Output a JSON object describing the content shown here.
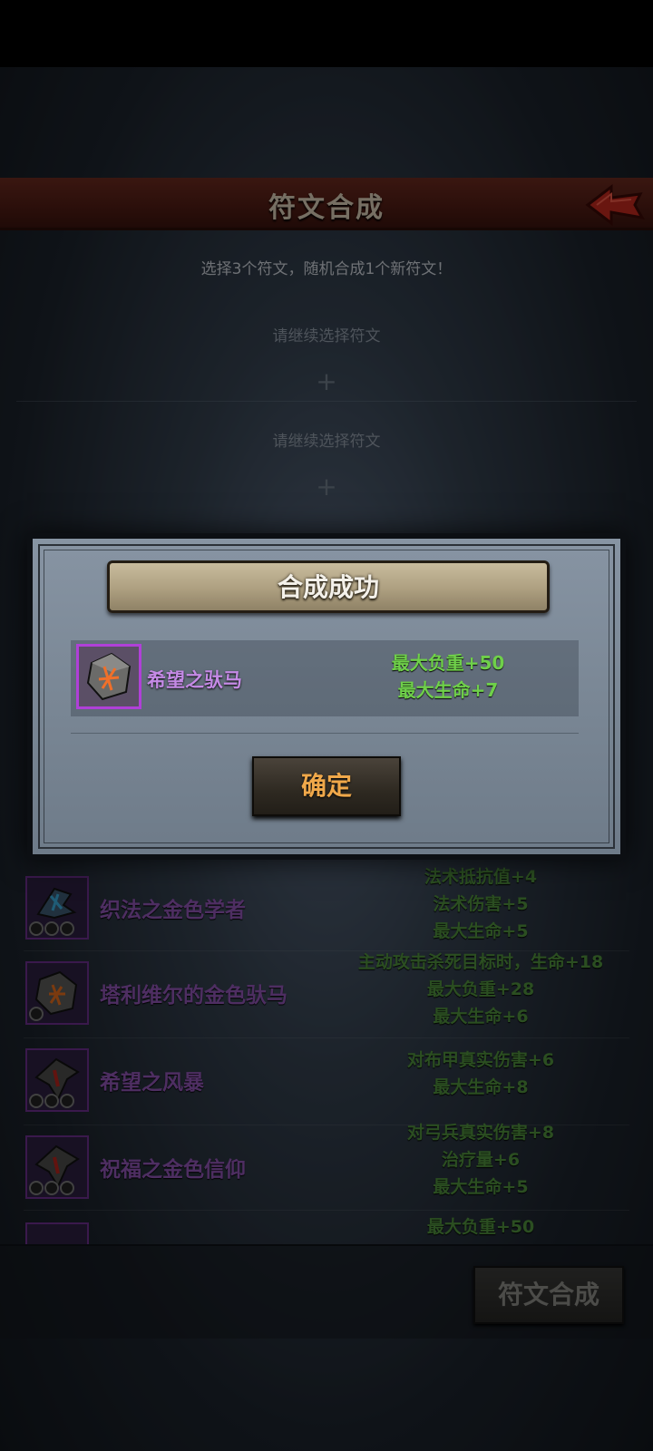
{
  "screen": {
    "title": "符文合成",
    "subtitle": "选择3个符文，随机合成1个新符文！",
    "slot_hints": [
      "请继续选择符文",
      "请继续选择符文"
    ],
    "plus": "+"
  },
  "rune_list": [
    {
      "name": "织法之金色学者",
      "stats": [
        "法术抵抗值+4",
        "法术伤害+5",
        "最大生命+5"
      ]
    },
    {
      "name": "塔利维尔的金色驮马",
      "stats": [
        "主动攻击杀死目标时，生命+18",
        "最大负重+28",
        "最大生命+6"
      ]
    },
    {
      "name": "希望之风暴",
      "stats": [
        "对布甲真实伤害+6",
        "最大生命+8"
      ]
    },
    {
      "name": "祝福之金色信仰",
      "stats": [
        "对弓兵真实伤害+8",
        "治疗量+6",
        "最大生命+5"
      ]
    },
    {
      "name": "",
      "stats": [
        "最大负重+50"
      ]
    }
  ],
  "compose_button": "符文合成",
  "modal": {
    "title": "合成成功",
    "result": {
      "name": "希望之驮马",
      "stats": [
        "最大负重+50",
        "最大生命+7"
      ]
    },
    "confirm": "确定"
  },
  "colors": {
    "rarity_purple": "#c58ae6",
    "stat_green": "#6fd04a",
    "confirm_text": "#f0a84a",
    "header_red": "#6a2a1f"
  },
  "icons": {
    "back": "red-back-arrow-icon",
    "rune": "rune-stone-icon"
  }
}
